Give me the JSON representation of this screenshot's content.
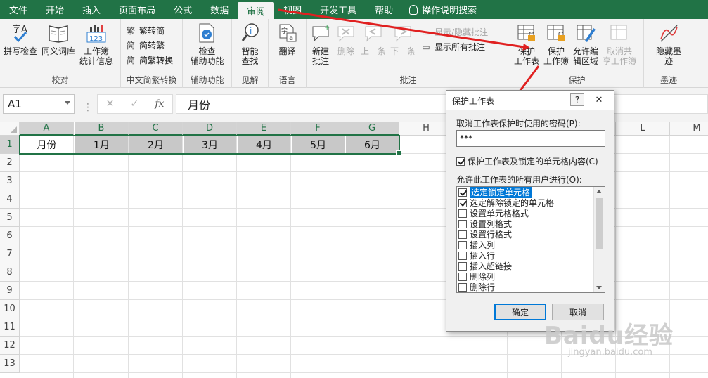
{
  "tabs": [
    "文件",
    "开始",
    "插入",
    "页面布局",
    "公式",
    "数据",
    "审阅",
    "视图",
    "开发工具",
    "帮助"
  ],
  "active_tab": "审阅",
  "tell_me": "操作说明搜索",
  "ribbon": {
    "proofing": {
      "label": "校对",
      "spell": "拼写检查",
      "thesaurus": "同义词库",
      "stats": "工作簿\n统计信息"
    },
    "chinese": {
      "label": "中文简繁转换",
      "to_trad": "繁转简",
      "to_simp": "简转繁",
      "convert": "简繁转换"
    },
    "accessibility": {
      "label": "辅助功能",
      "check": "检查\n辅助功能"
    },
    "insights": {
      "label": "见解",
      "smart": "智能\n查找"
    },
    "language": {
      "label": "语言",
      "translate": "翻译"
    },
    "comments": {
      "label": "批注",
      "new": "新建\n批注",
      "delete": "删除",
      "prev": "上一条",
      "next": "下一条",
      "show_hide": "显示/隐藏批注",
      "show_all": "显示所有批注"
    },
    "protect": {
      "label": "保护",
      "sheet": "保护\n工作表",
      "workbook": "保护\n工作簿",
      "allow": "允许编\n辑区域",
      "unshare": "取消共\n享工作簿"
    },
    "ink": {
      "label": "墨迹",
      "hide": "隐藏墨\n迹"
    }
  },
  "formula_bar": {
    "name_box": "A1",
    "cancel": "✕",
    "enter": "✓",
    "fx": "fx",
    "content": "月份"
  },
  "sheet": {
    "columns": [
      "A",
      "B",
      "C",
      "D",
      "E",
      "F",
      "G",
      "H",
      "I",
      "J",
      "K",
      "L",
      "M"
    ],
    "rows": [
      "1",
      "2",
      "3",
      "4",
      "5",
      "6",
      "7",
      "8",
      "9",
      "10",
      "11",
      "12",
      "13"
    ],
    "row1": [
      "月份",
      "1月",
      "2月",
      "3月",
      "4月",
      "5月",
      "6月"
    ]
  },
  "dialog": {
    "title": "保护工作表",
    "help": "?",
    "close": "✕",
    "password_label": "取消工作表保护时使用的密码(P):",
    "password_value": "***",
    "protect_label": "保护工作表及锁定的单元格内容(C)",
    "protect_checked": true,
    "allow_label": "允许此工作表的所有用户进行(O):",
    "permissions": [
      {
        "label": "选定锁定单元格",
        "checked": true
      },
      {
        "label": "选定解除锁定的单元格",
        "checked": true
      },
      {
        "label": "设置单元格格式",
        "checked": false
      },
      {
        "label": "设置列格式",
        "checked": false
      },
      {
        "label": "设置行格式",
        "checked": false
      },
      {
        "label": "插入列",
        "checked": false
      },
      {
        "label": "插入行",
        "checked": false
      },
      {
        "label": "插入超链接",
        "checked": false
      },
      {
        "label": "删除列",
        "checked": false
      },
      {
        "label": "删除行",
        "checked": false
      }
    ],
    "ok": "确定",
    "cancel": "取消"
  },
  "watermark": {
    "brand": "Baidu经验",
    "url": "jingyan.baidu.com"
  },
  "colors": {
    "excel_green": "#217346",
    "arrow_red": "#e02020",
    "selection_blue": "#0078d7"
  }
}
